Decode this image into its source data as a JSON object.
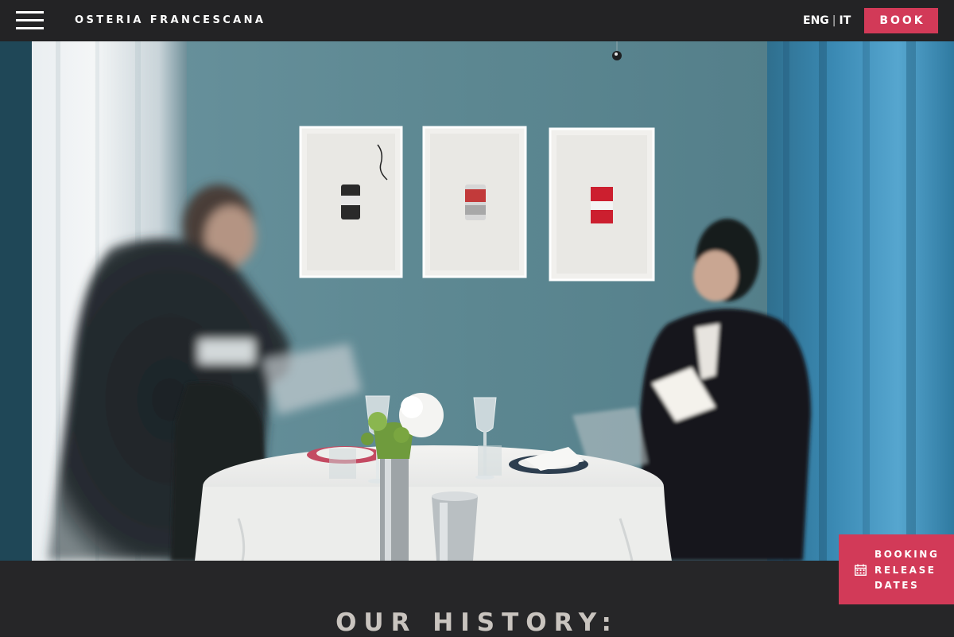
{
  "header": {
    "brand": "OSTERIA FRANCESCANA",
    "menu_icon": "hamburger-menu-icon",
    "languages": [
      {
        "label": "ENG"
      },
      {
        "label": "IT"
      }
    ],
    "lang_separator": "|",
    "book_label": "BOOK"
  },
  "hero": {
    "image": "restaurant-dining-room-photo"
  },
  "floating": {
    "icon": "calendar-icon",
    "lines": [
      "BOOKING",
      "RELEASE",
      "DATES"
    ]
  },
  "history": {
    "title": "OUR HISTORY:"
  },
  "colors": {
    "header_bg": "#232325",
    "accent": "#d23a58",
    "section_bg": "#262628",
    "title": "#c9c4bf",
    "wall": "#5f8a95"
  }
}
